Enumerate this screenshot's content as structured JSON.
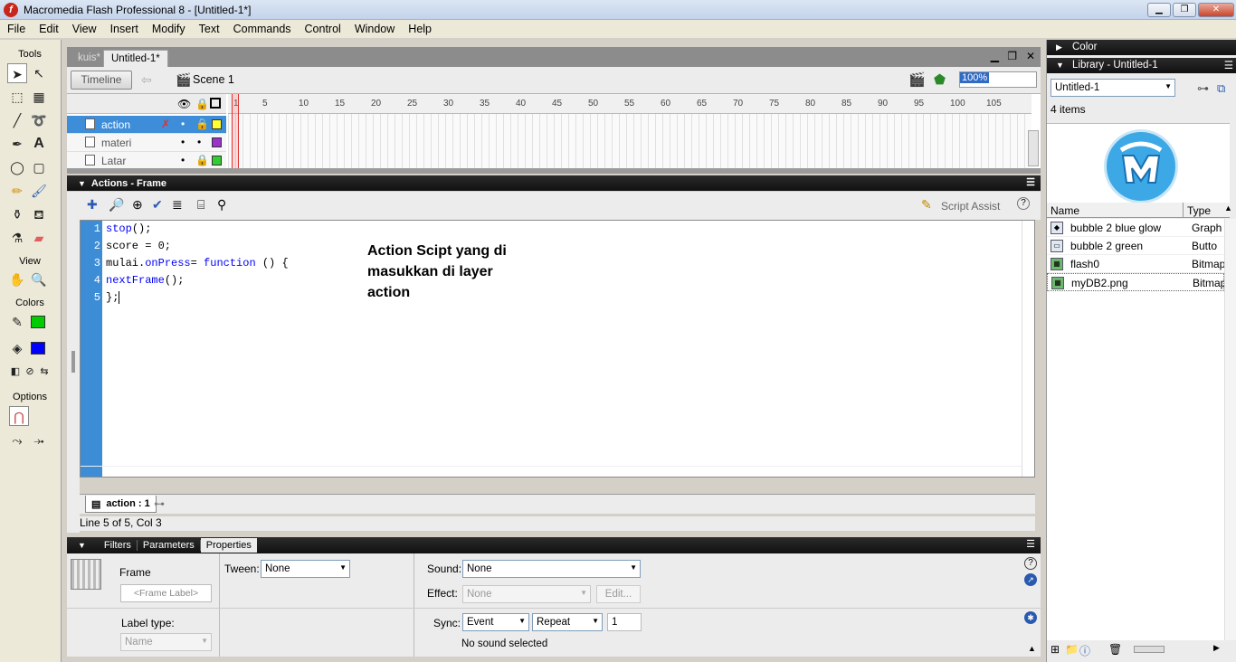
{
  "window": {
    "title": "Macromedia Flash Professional 8 - [Untitled-1*]",
    "app_icon": "flash-logo-icon",
    "minimize": "minimize-icon",
    "restore": "restore-icon",
    "close": "close-icon"
  },
  "menu": [
    "File",
    "Edit",
    "View",
    "Insert",
    "Modify",
    "Text",
    "Commands",
    "Control",
    "Window",
    "Help"
  ],
  "tools": {
    "title": "Tools",
    "view_title": "View",
    "colors_title": "Colors",
    "options_title": "Options",
    "stroke_color": "#00cc00",
    "fill_color": "#0000ff"
  },
  "doc_tabs": [
    "kuis*",
    "Untitled-1*"
  ],
  "timeline": {
    "button": "Timeline",
    "scene": "Scene 1",
    "zoom": "100%",
    "ruler": [
      "1",
      "5",
      "10",
      "15",
      "20",
      "25",
      "30",
      "35",
      "40",
      "45",
      "50",
      "55",
      "60",
      "65",
      "70",
      "75",
      "80",
      "85",
      "90",
      "95",
      "100",
      "105"
    ],
    "layers": [
      {
        "name": "action",
        "color": "#ffff33",
        "selected": true
      },
      {
        "name": "materi",
        "color": "#9933cc",
        "selected": false
      },
      {
        "name": "Latar",
        "color": "#33cc33",
        "selected": false
      }
    ]
  },
  "actions": {
    "title": "Actions - Frame",
    "script_assist": "Script Assist",
    "lines": [
      "1",
      "2",
      "3",
      "4",
      "5"
    ],
    "code": {
      "l1_a": "stop",
      "l1_b": "();",
      "l2": "score = 0;",
      "l3_a": "mulai.",
      "l3_b": "onPress",
      "l3_c": "= ",
      "l3_d": "function",
      "l3_e": "() {",
      "l4_a": "nextFrame",
      "l4_b": "();",
      "l5": "};"
    },
    "annotation": "Action Scipt yang di masukkan di layer action",
    "script_tab": "action : 1",
    "status": "Line 5 of 5, Col 3"
  },
  "properties": {
    "tabs": [
      "Filters",
      "Parameters",
      "Properties"
    ],
    "frame_label": "Frame",
    "frame_placeholder": "<Frame Label>",
    "tween_label": "Tween:",
    "tween_value": "None",
    "sound_label": "Sound:",
    "sound_value": "None",
    "effect_label": "Effect:",
    "effect_value": "None",
    "edit_button": "Edit...",
    "sync_label": "Sync:",
    "sync_value": "Event",
    "repeat_value": "Repeat",
    "repeat_count": "1",
    "label_type_label": "Label type:",
    "label_type_value": "Name",
    "no_sound": "No sound selected"
  },
  "color_panel": {
    "title": "Color"
  },
  "library": {
    "title": "Library - Untitled-1",
    "doc": "Untitled-1",
    "count": "4 items",
    "col_name": "Name",
    "col_type": "Type",
    "items": [
      {
        "name": "bubble 2 blue glow",
        "type": "Graph",
        "icon": "graphic-symbol-icon"
      },
      {
        "name": "bubble 2 green",
        "type": "Butto",
        "icon": "button-symbol-icon"
      },
      {
        "name": "flash0",
        "type": "Bitmap",
        "icon": "bitmap-icon"
      },
      {
        "name": "myDB2.png",
        "type": "Bitmap",
        "icon": "bitmap-icon"
      }
    ]
  }
}
